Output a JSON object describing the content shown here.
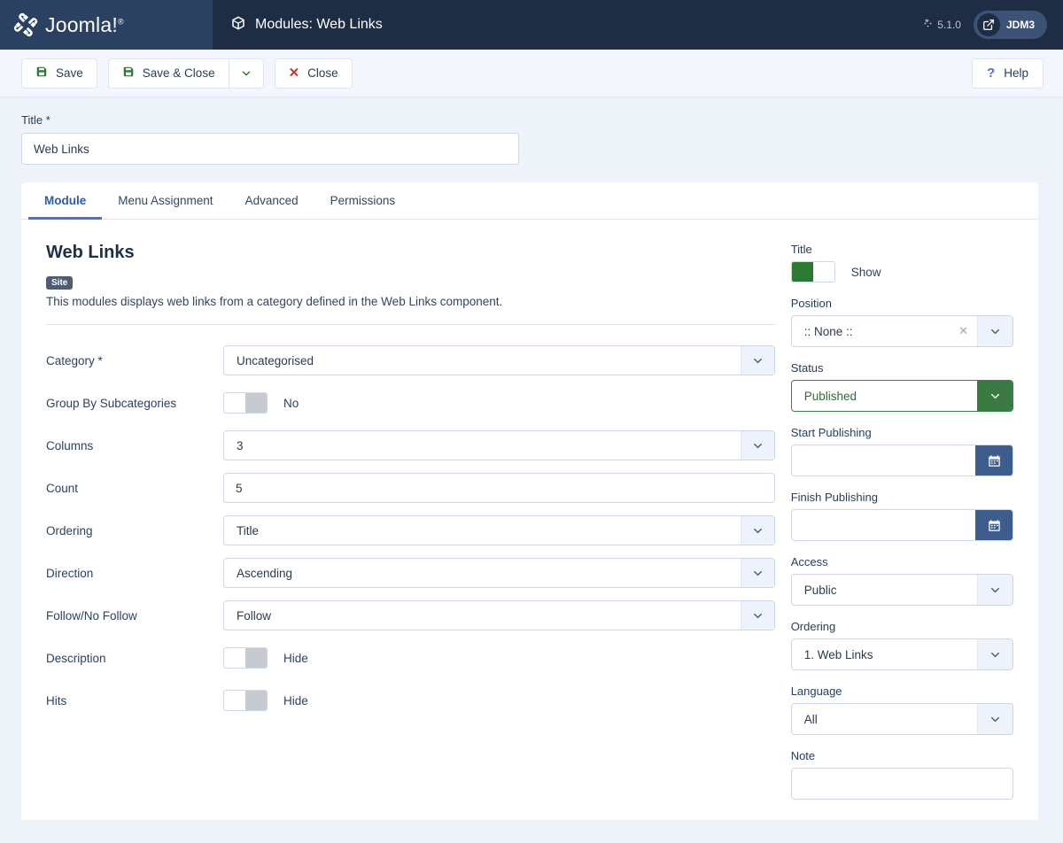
{
  "header": {
    "brand_name": "Joomla!",
    "brand_tm": "®",
    "page_title": "Modules: Web Links",
    "version": "5.1.0",
    "username": "JDM3"
  },
  "toolbar": {
    "save_label": "Save",
    "save_close_label": "Save & Close",
    "close_label": "Close",
    "help_label": "Help"
  },
  "title_field": {
    "label": "Title *",
    "value": "Web Links"
  },
  "tabs": [
    {
      "label": "Module",
      "active": true
    },
    {
      "label": "Menu Assignment",
      "active": false
    },
    {
      "label": "Advanced",
      "active": false
    },
    {
      "label": "Permissions",
      "active": false
    }
  ],
  "module": {
    "name": "Web Links",
    "badge": "Site",
    "description": "This modules displays web links from a category defined in the Web Links component."
  },
  "fields": {
    "category": {
      "label": "Category *",
      "value": "Uncategorised"
    },
    "group_by_subcategories": {
      "label": "Group By Subcategories",
      "value": "No",
      "state": "off"
    },
    "columns": {
      "label": "Columns",
      "value": "3"
    },
    "count": {
      "label": "Count",
      "value": "5"
    },
    "ordering": {
      "label": "Ordering",
      "value": "Title"
    },
    "direction": {
      "label": "Direction",
      "value": "Ascending"
    },
    "follow": {
      "label": "Follow/No Follow",
      "value": "Follow"
    },
    "description": {
      "label": "Description",
      "value": "Hide",
      "state": "off"
    },
    "hits": {
      "label": "Hits",
      "value": "Hide",
      "state": "off"
    }
  },
  "sidebar": {
    "title_toggle": {
      "label": "Title",
      "value": "Show",
      "state": "on"
    },
    "position": {
      "label": "Position",
      "value": ":: None ::"
    },
    "status": {
      "label": "Status",
      "value": "Published"
    },
    "start_publishing": {
      "label": "Start Publishing",
      "value": ""
    },
    "finish_publishing": {
      "label": "Finish Publishing",
      "value": ""
    },
    "access": {
      "label": "Access",
      "value": "Public"
    },
    "ordering": {
      "label": "Ordering",
      "value": "1. Web Links"
    },
    "language": {
      "label": "Language",
      "value": "All"
    },
    "note": {
      "label": "Note",
      "value": ""
    }
  },
  "colors": {
    "brand_bg": "#2b4161",
    "header_bg": "#1f2d44",
    "accent_blue": "#2a5db0",
    "success_green": "#2b7a33",
    "danger_red": "#c9372c"
  }
}
